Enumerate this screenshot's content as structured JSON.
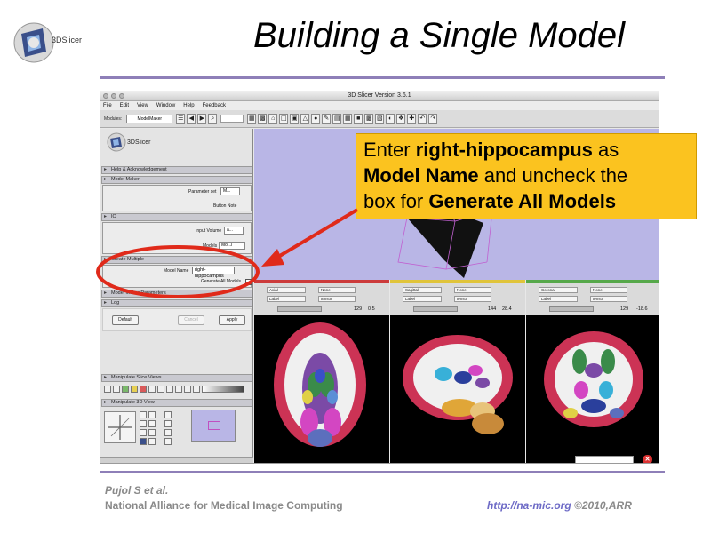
{
  "slide": {
    "title": "Building a Single Model",
    "logo_text": "3DSlicer",
    "footer": {
      "authors": "Pujol S et al.",
      "org": "National Alliance for Medical Image Computing",
      "url": "http://na-mic.org",
      "copyright": "©2010,ARR"
    }
  },
  "window": {
    "title": "3D Slicer Version 3.6.1",
    "menu": [
      "File",
      "Edit",
      "View",
      "Window",
      "Help",
      "Feedback"
    ],
    "toolbar": {
      "modules_label": "Modules:",
      "module_value": "ModelMaker"
    }
  },
  "panel": {
    "logo_text": "3DSlicer",
    "sections": {
      "help": "Help & Acknowledgement",
      "model_maker": "Model Maker",
      "io": "IO",
      "create": "Create Multiple",
      "parameters": "Model Maker Parameters",
      "log": "Log",
      "manipulate_slice": "Manipulate Slice Views",
      "manipulate_3d": "Manipulate 3D View"
    },
    "parameter_set_label": "Parameter set",
    "parameter_set_value": "M...",
    "button_note": "Button Note",
    "input_volume_label": "Input Volume",
    "input_volume_value": "a...",
    "models_label": "Models",
    "models_value": "Mo...l",
    "model_name_label": "Model Name",
    "model_name_value": "right-hippocampus",
    "generate_all_label": "Generate All Models",
    "buttons": {
      "default": "Default",
      "cancel": "Cancel",
      "apply": "Apply"
    }
  },
  "slices": [
    {
      "name": "red",
      "orientation": "Axial",
      "label": "Label",
      "fg": "None",
      "bg": "tensor",
      "slider_value": "129",
      "offset": "0.5",
      "bar_color": "#cc3b3b"
    },
    {
      "name": "yellow",
      "orientation": "Sagittal",
      "label": "Label",
      "fg": "None",
      "bg": "tensor",
      "slider_value": "144",
      "offset": "28.4",
      "bar_color": "#e0c43a"
    },
    {
      "name": "green",
      "orientation": "Coronal",
      "label": "Label",
      "fg": "None",
      "bg": "tensor",
      "slider_value": "129",
      "offset": "-18.6",
      "bar_color": "#56a84a"
    }
  ],
  "callout": {
    "line1_prefix": "Enter ",
    "line1_bold": "right-hippocampus",
    "line1_suffix": " as",
    "line2_bold": "Model Name",
    "line2_suffix": " and uncheck the",
    "line3_prefix": "box for ",
    "line3_bold": "Generate All Models"
  },
  "colors": {
    "rule": "#8e7fb8",
    "callout": "#fbc31f",
    "annotation": "#e02a1a",
    "view_bg": "#b9b6e6"
  }
}
